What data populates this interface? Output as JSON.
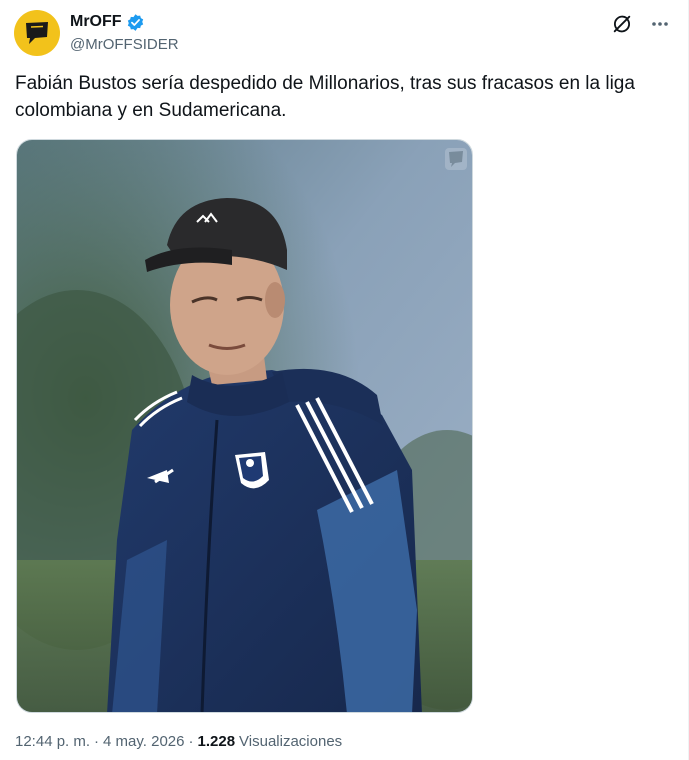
{
  "author": {
    "display_name": "MrOFF",
    "handle": "@MrOFFSIDER",
    "verified": true,
    "avatar_icon": "speech-bubble-logo-icon",
    "avatar_color": "#f2c21b"
  },
  "header_actions": {
    "grok_icon": "grok-icon",
    "more_icon": "more-dots-icon"
  },
  "tweet": {
    "text": "Fabián Bustos sería despedido de Millonarios, tras sus fracasos en la liga\ncolombiana y en Sudamericana."
  },
  "media": {
    "type": "photo",
    "watermark_icon": "speech-bubble-watermark-icon"
  },
  "meta": {
    "time": "12:44 p. m.",
    "separator": "·",
    "date": "4 may. 2026",
    "views_count": "1.228",
    "views_label": "Visualizaciones"
  },
  "colors": {
    "text_primary": "#0f1419",
    "text_secondary": "#536471",
    "verified_blue": "#1d9bf0",
    "jacket_navy": "#1f3563"
  }
}
